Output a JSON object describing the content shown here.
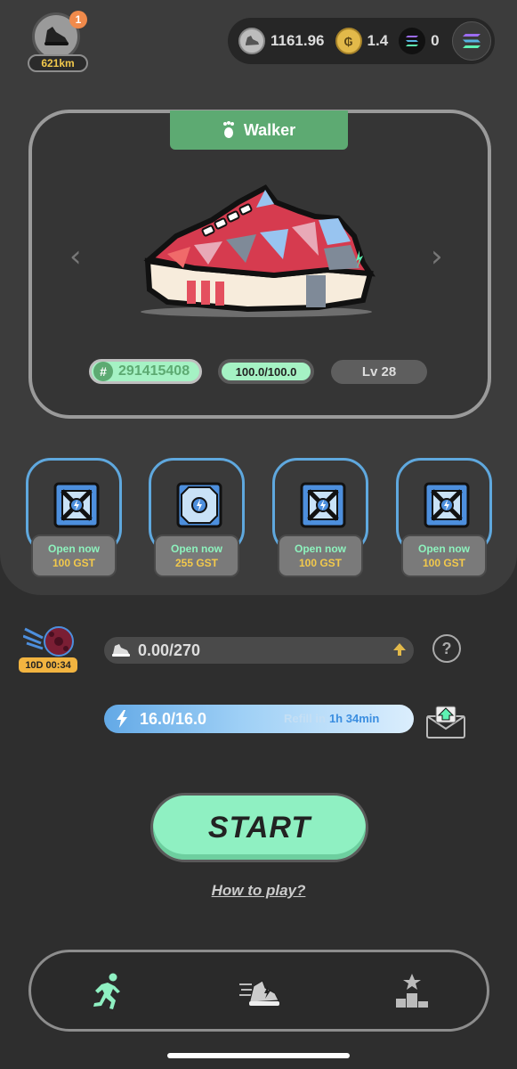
{
  "profile": {
    "notification_count": "1",
    "distance": "621km"
  },
  "balances": {
    "gmt": "1161.96",
    "gst": "1.4",
    "sol": "0"
  },
  "sneaker": {
    "type": "Walker",
    "id": "291415408",
    "durability": "100.0/100.0",
    "level": "Lv 28"
  },
  "mystery_boxes": [
    {
      "label": "Open now",
      "cost": "100 GST"
    },
    {
      "label": "Open now",
      "cost": "255 GST"
    },
    {
      "label": "Open now",
      "cost": "100 GST"
    },
    {
      "label": "Open now",
      "cost": "100 GST"
    }
  ],
  "achievement": {
    "timer": "10D 00:34",
    "progress": "0.00/270",
    "help_label": "?"
  },
  "energy": {
    "value": "16.0/16.0",
    "refill_label": "Refill in",
    "refill_time": "1h 34min"
  },
  "start_label": "START",
  "howto_label": "How to play?",
  "colors": {
    "accent_green": "#8ff0c2",
    "walker_green": "#5daa72",
    "energy_blue": "#63a9e6",
    "gold": "#f2c94c"
  },
  "nav": [
    "run-icon",
    "sneaker-speed-icon",
    "leaderboard-icon"
  ]
}
